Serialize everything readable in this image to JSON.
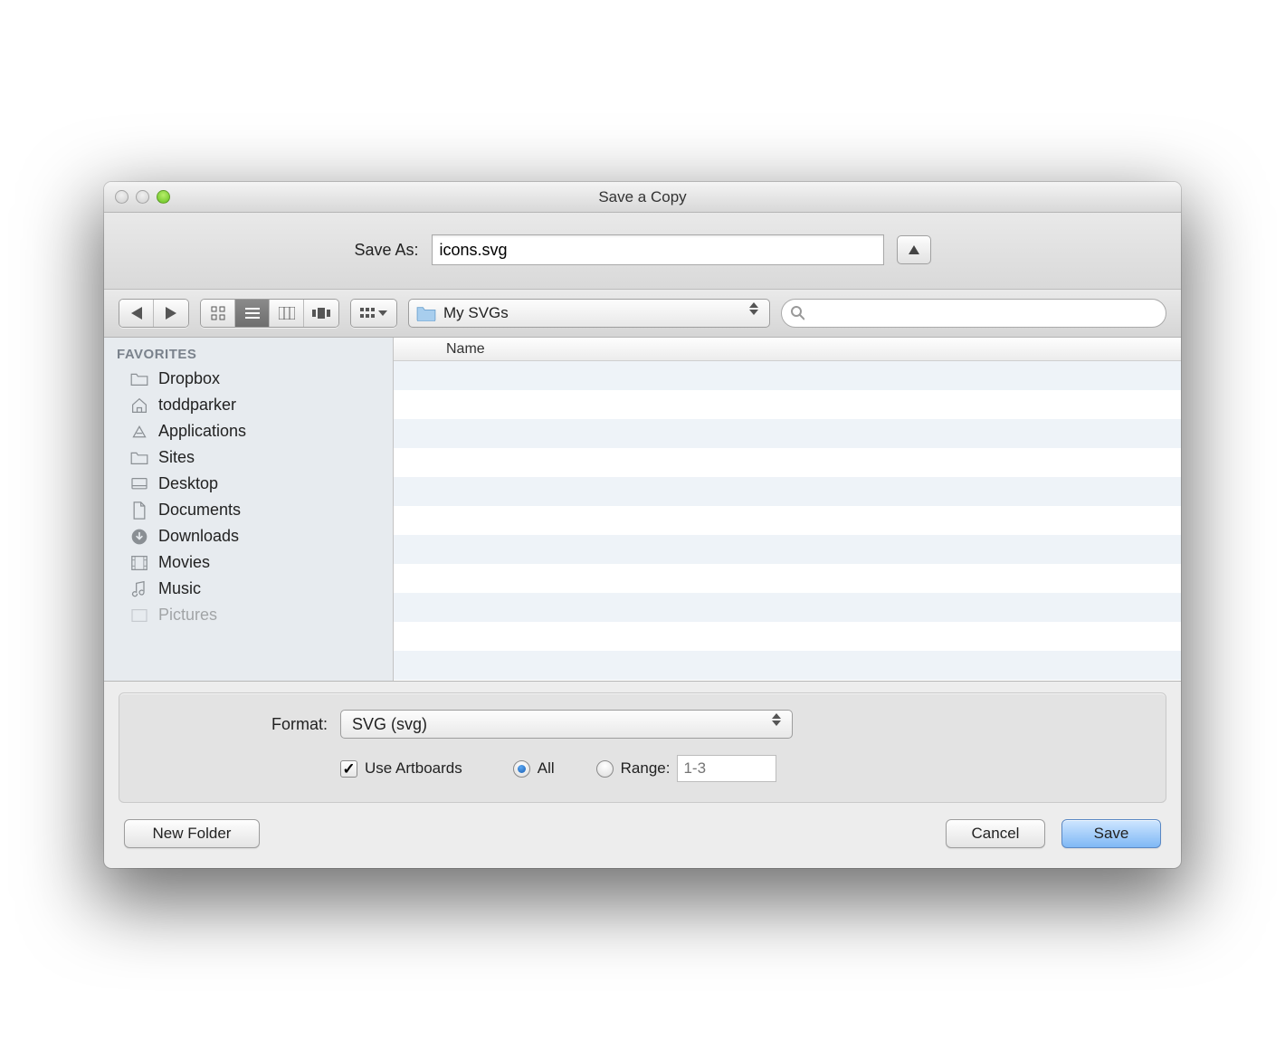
{
  "window": {
    "title": "Save a Copy"
  },
  "saveas": {
    "label": "Save As:",
    "filename": "icons.svg"
  },
  "toolbar": {
    "path_folder": "My SVGs",
    "search_placeholder": ""
  },
  "sidebar": {
    "header": "FAVORITES",
    "items": [
      {
        "icon": "folder",
        "label": "Dropbox"
      },
      {
        "icon": "home",
        "label": "toddparker"
      },
      {
        "icon": "apps",
        "label": "Applications"
      },
      {
        "icon": "folder",
        "label": "Sites"
      },
      {
        "icon": "desktop",
        "label": "Desktop"
      },
      {
        "icon": "documents",
        "label": "Documents"
      },
      {
        "icon": "downloads",
        "label": "Downloads"
      },
      {
        "icon": "movies",
        "label": "Movies"
      },
      {
        "icon": "music",
        "label": "Music"
      },
      {
        "icon": "pictures",
        "label": "Pictures"
      }
    ]
  },
  "filelist": {
    "column_header": "Name"
  },
  "format": {
    "label": "Format:",
    "value": "SVG (svg)",
    "use_artboards_label": "Use Artboards",
    "use_artboards_checked": true,
    "all_label": "All",
    "range_label": "Range:",
    "range_placeholder": "1-3",
    "radio_selected": "all"
  },
  "buttons": {
    "new_folder": "New Folder",
    "cancel": "Cancel",
    "save": "Save"
  }
}
